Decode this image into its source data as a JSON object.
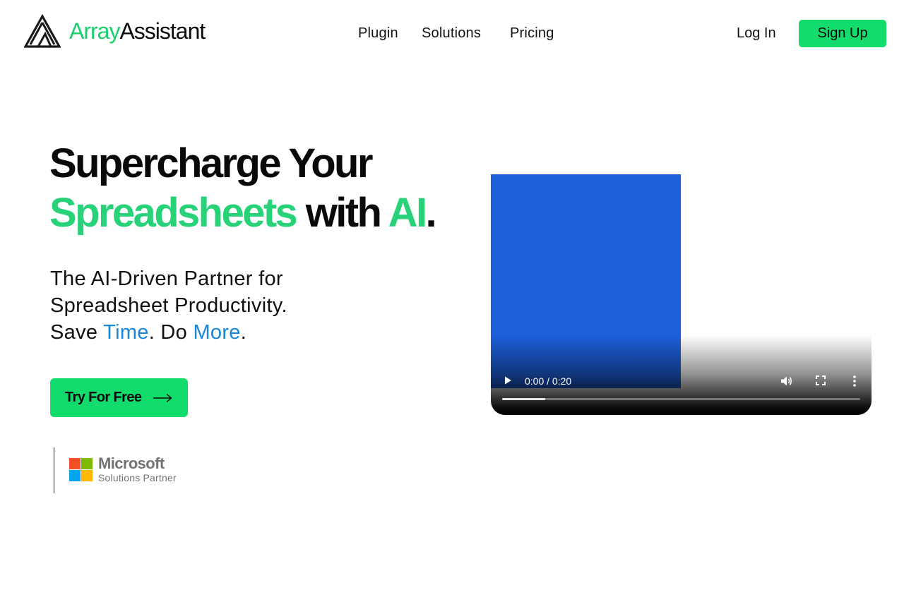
{
  "header": {
    "brand_part1": "Array",
    "brand_part2": "Assistant",
    "nav": [
      "Plugin",
      "Solutions",
      "Pricing"
    ],
    "login": "Log In",
    "signup": "Sign Up"
  },
  "hero": {
    "title_line1": "Supercharge Your",
    "title_word1": "Spreadsheets",
    "title_word2": " with ",
    "title_word3": "AI",
    "title_period": ".",
    "sub_line1": "The AI-Driven Partner for",
    "sub_line2": "Spreadsheet Productivity.",
    "sub_save": "Save ",
    "sub_time": "Time",
    "sub_do": ". Do ",
    "sub_more": "More",
    "sub_end": ".",
    "cta": "Try For Free"
  },
  "partner": {
    "name": "Microsoft",
    "label": "Solutions Partner"
  },
  "video": {
    "time": "0:00 / 0:20",
    "progress": 0.12
  },
  "colors": {
    "brand_green": "#1ccf6e",
    "button_green": "#12dc6c",
    "link_blue": "#1a86d6",
    "video_blue": "#1d5fd9",
    "ms_red": "#f25022",
    "ms_green": "#7fba00",
    "ms_blue": "#00a4ef",
    "ms_yellow": "#ffb900"
  }
}
